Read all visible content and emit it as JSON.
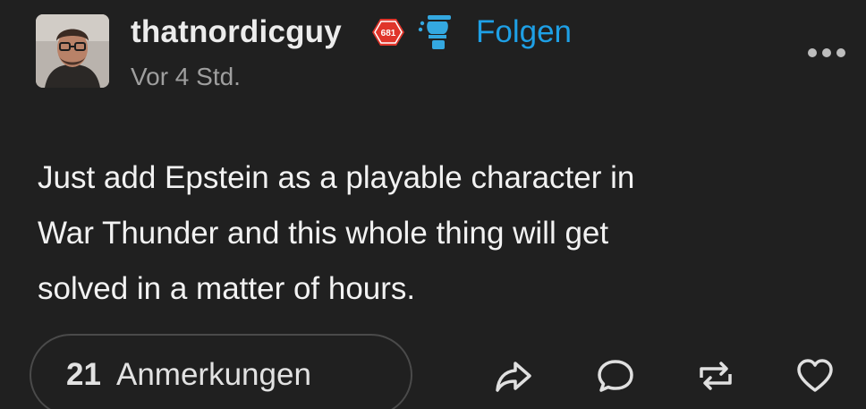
{
  "post": {
    "author": {
      "username": "thatnordicguy",
      "follow_label": "Folgen",
      "timestamp": "Vor 4 Std.",
      "badge_text": "681"
    },
    "body_lines": [
      "Just add Epstein as a playable character in",
      "War Thunder and this whole thing will get",
      "solved in a matter of hours."
    ],
    "footer": {
      "notes_count": "21",
      "notes_label": "Anmerkungen"
    }
  },
  "colors": {
    "background": "#202020",
    "follow": "#1ea0e6",
    "badge_red": "#e0352b",
    "badge_blue": "#34a8e0",
    "muted_text": "#9f9f9f"
  },
  "icons": {
    "badge_1": "red-hexagon-badge-icon",
    "badge_2": "blue-propeller-badge-icon",
    "more": "more-dots-icon",
    "share": "share-arrow-icon",
    "reply": "reply-bubble-icon",
    "reblog": "reblog-icon",
    "like": "heart-icon"
  }
}
